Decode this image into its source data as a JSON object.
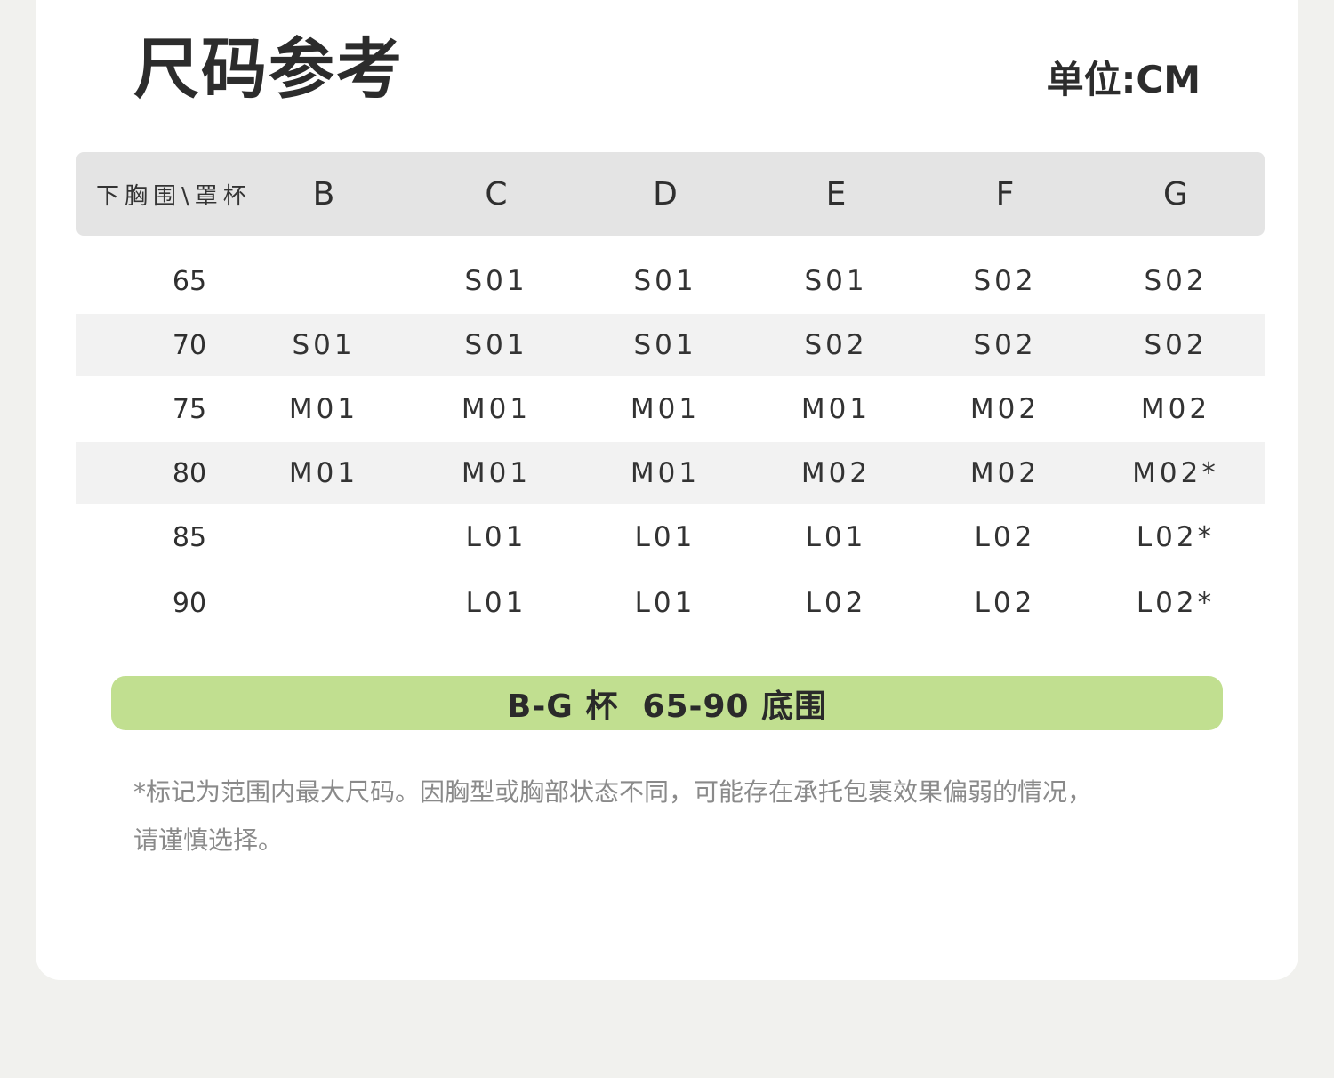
{
  "title": "尺码参考",
  "unit": "单位:CM",
  "table": {
    "corner_label": "下胸围\\罩杯",
    "columns": [
      "B",
      "C",
      "D",
      "E",
      "F",
      "G"
    ],
    "rows": [
      {
        "band": "65",
        "cells": [
          "",
          "S01",
          "S01",
          "S01",
          "S02",
          "S02"
        ]
      },
      {
        "band": "70",
        "cells": [
          "S01",
          "S01",
          "S01",
          "S02",
          "S02",
          "S02"
        ]
      },
      {
        "band": "75",
        "cells": [
          "M01",
          "M01",
          "M01",
          "M01",
          "M02",
          "M02"
        ]
      },
      {
        "band": "80",
        "cells": [
          "M01",
          "M01",
          "M01",
          "M02",
          "M02",
          "M02*"
        ]
      },
      {
        "band": "85",
        "cells": [
          "",
          "L01",
          "L01",
          "L01",
          "L02",
          "L02*"
        ]
      },
      {
        "band": "90",
        "cells": [
          "",
          "L01",
          "L01",
          "L02",
          "L02",
          "L02*"
        ]
      }
    ]
  },
  "banner": "B-G 杯  65-90 底围",
  "note": {
    "line1": "*标记为范围内最大尺码。因胸型或胸部状态不同，可能存在承托包裹效果偏弱的情况，",
    "line2": "请谨慎选择。"
  },
  "colors": {
    "page_bg": "#f1f1ee",
    "card_bg": "#ffffff",
    "header_bg": "#e4e4e4",
    "stripe_bg": "#f2f2f2",
    "banner_bg": "#c1df90",
    "note_text": "#8a8a8a"
  }
}
